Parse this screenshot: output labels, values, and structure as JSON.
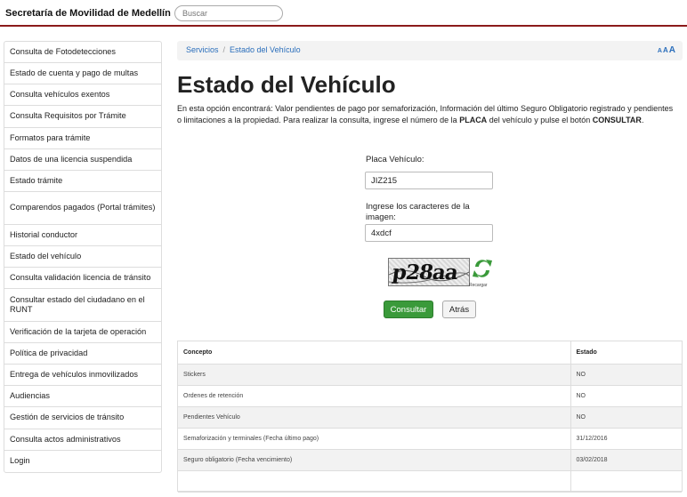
{
  "header": {
    "brand": "Secretaría de Movilidad de Medellín",
    "search_placeholder": "Buscar",
    "accent_color": "#8b1a1a"
  },
  "sidebar": {
    "items": [
      {
        "label": "Consulta de Fotodetecciones"
      },
      {
        "label": "Estado de cuenta y pago de multas"
      },
      {
        "label": "Consulta vehículos exentos"
      },
      {
        "label": "Consulta Requisitos por Trámite"
      },
      {
        "label": "Formatos para trámite"
      },
      {
        "label": "Datos de una licencia suspendida"
      },
      {
        "label": "Estado trámite"
      },
      {
        "label": "Comparendos pagados (Portal trámites)"
      },
      {
        "label": "Historial conductor"
      },
      {
        "label": "Estado del vehículo"
      },
      {
        "label": "Consulta validación licencia de tránsito"
      },
      {
        "label": "Consultar estado del ciudadano en el RUNT"
      },
      {
        "label": "Verificación de la tarjeta de operación"
      },
      {
        "label": "Política de privacidad"
      },
      {
        "label": "Entrega de vehículos inmovilizados"
      },
      {
        "label": "Audiencias"
      },
      {
        "label": "Gestión de servicios de tránsito"
      },
      {
        "label": "Consulta actos administrativos"
      },
      {
        "label": "Login"
      }
    ]
  },
  "breadcrumb": {
    "items": [
      "Servicios",
      "Estado del Vehículo"
    ],
    "separator": "/",
    "font_sizer": [
      "A",
      "A",
      "A"
    ]
  },
  "main": {
    "title": "Estado del Vehículo",
    "intro_part1": "En esta opción encontrará: Valor pendientes de pago por  semaforización, Información del último Seguro Obligatorio registrado y pendientes o limitaciones a la propiedad.  Para realizar la consulta, ingrese el número de la ",
    "intro_bold1": "PLACA",
    "intro_part2": " del vehículo y pulse el botón ",
    "intro_bold2": "CONSULTAR",
    "intro_part3": "."
  },
  "form": {
    "placa_label": "Placa Vehículo:",
    "placa_value": "JIZ215",
    "captcha_label": "Ingrese los caracteres de la imagen:",
    "captcha_value": "4xdcf",
    "captcha_image_text": "p28aa",
    "reload_label": "Recargar",
    "consultar_label": "Consultar",
    "atras_label": "Atrás",
    "primary_color": "#3a9a3a"
  },
  "results": {
    "headers": [
      "Concepto",
      "Estado"
    ],
    "rows": [
      [
        "Stickers",
        "NO"
      ],
      [
        "Ordenes de retención",
        "NO"
      ],
      [
        "Pendientes Vehículo",
        "NO"
      ],
      [
        "Semaforización y terminales (Fecha último pago)",
        "31/12/2016"
      ],
      [
        "Seguro obligatorio (Fecha vencimiento)",
        "03/02/2018"
      ],
      [
        "",
        ""
      ]
    ]
  }
}
